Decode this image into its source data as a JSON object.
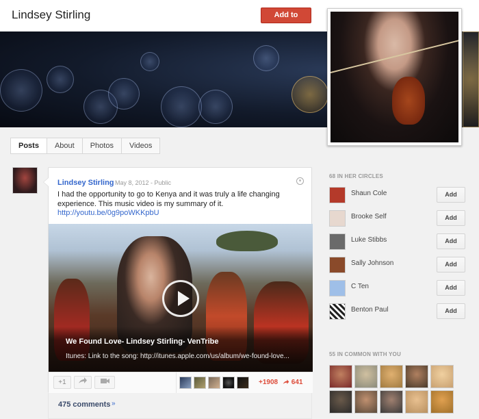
{
  "profile": {
    "name": "Lindsey Stirling",
    "add_to_circles": "Add to circles"
  },
  "tabs": [
    {
      "label": "Posts",
      "active": true
    },
    {
      "label": "About",
      "active": false
    },
    {
      "label": "Photos",
      "active": false
    },
    {
      "label": "Videos",
      "active": false
    }
  ],
  "post": {
    "author": "Lindsey Stirling",
    "date": "May 8, 2012",
    "visibility": "Public",
    "text": "I had the opportunity to go to Kenya and it was truly a life changing experience. This music video is my summary of it.",
    "link": "http://youtu.be/0g9poWKKpbU",
    "video": {
      "title": "We Found Love- Lindsey Stirling- VenTribe",
      "description": "Itunes: Link to the song: http://itunes.apple.com/us/album/we-found-love..."
    },
    "actions": {
      "plus_one": "+1",
      "plus_count": "+1908",
      "share_count": "641"
    },
    "comments": "475 comments"
  },
  "circles": {
    "heading": "68 IN HER CIRCLES",
    "add_label": "Add",
    "people": [
      {
        "name": "Shaun Cole",
        "color": "#b43a2a"
      },
      {
        "name": "Brooke Self",
        "color": "#e7d8cf"
      },
      {
        "name": "Luke Stibbs",
        "color": "#6a6a6a"
      },
      {
        "name": "Sally Johnson",
        "color": "#8a4a2a"
      },
      {
        "name": "C Ten",
        "color": "#9fbfe8"
      },
      {
        "name": "Benton Paul",
        "color": "#222222"
      }
    ]
  },
  "common": {
    "heading": "55 IN COMMON WITH YOU",
    "faces": [
      "#7a2a2a",
      "#8a8a7a",
      "#a07a40",
      "#4a3a2a",
      "#c8a070",
      "#2a2a2a",
      "#5a4a3a",
      "#3a3a3a",
      "#b89060",
      "#a0702a"
    ]
  },
  "icons": {
    "share": "share-icon",
    "video": "video-camera-icon",
    "chevron": "chevron-down-icon"
  }
}
